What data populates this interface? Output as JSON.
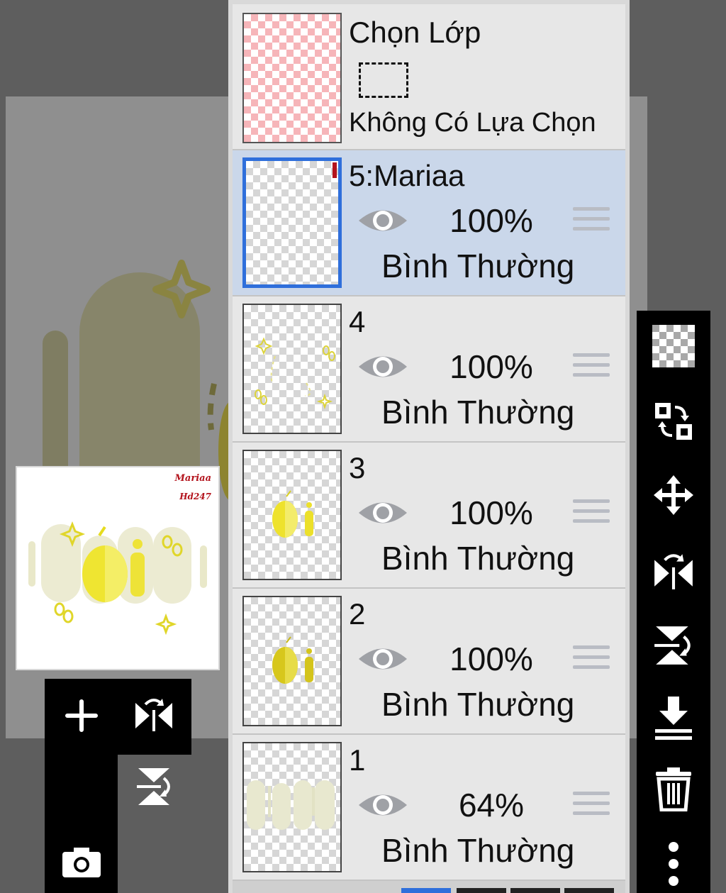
{
  "selection_layer": {
    "title": "Chọn Lớp",
    "status": "Không Có Lựa Chọn"
  },
  "layers": [
    {
      "name": "5:Mariaa",
      "opacity": "100%",
      "blend": "Bình Thường",
      "selected": true
    },
    {
      "name": "4",
      "opacity": "100%",
      "blend": "Bình Thường",
      "selected": false
    },
    {
      "name": "3",
      "opacity": "100%",
      "blend": "Bình Thường",
      "selected": false
    },
    {
      "name": "2",
      "opacity": "100%",
      "blend": "Bình Thường",
      "selected": false
    },
    {
      "name": "1",
      "opacity": "64%",
      "blend": "Bình Thường",
      "selected": false
    }
  ],
  "preview": {
    "signature_line1": "Mariaa",
    "signature_line2": "Hd247"
  },
  "colors": {
    "selected_row": "#cad7ea",
    "selected_border": "#2f6fdb",
    "artwork_yellow": "#e6dc1e",
    "signature_red": "#b3131c"
  }
}
